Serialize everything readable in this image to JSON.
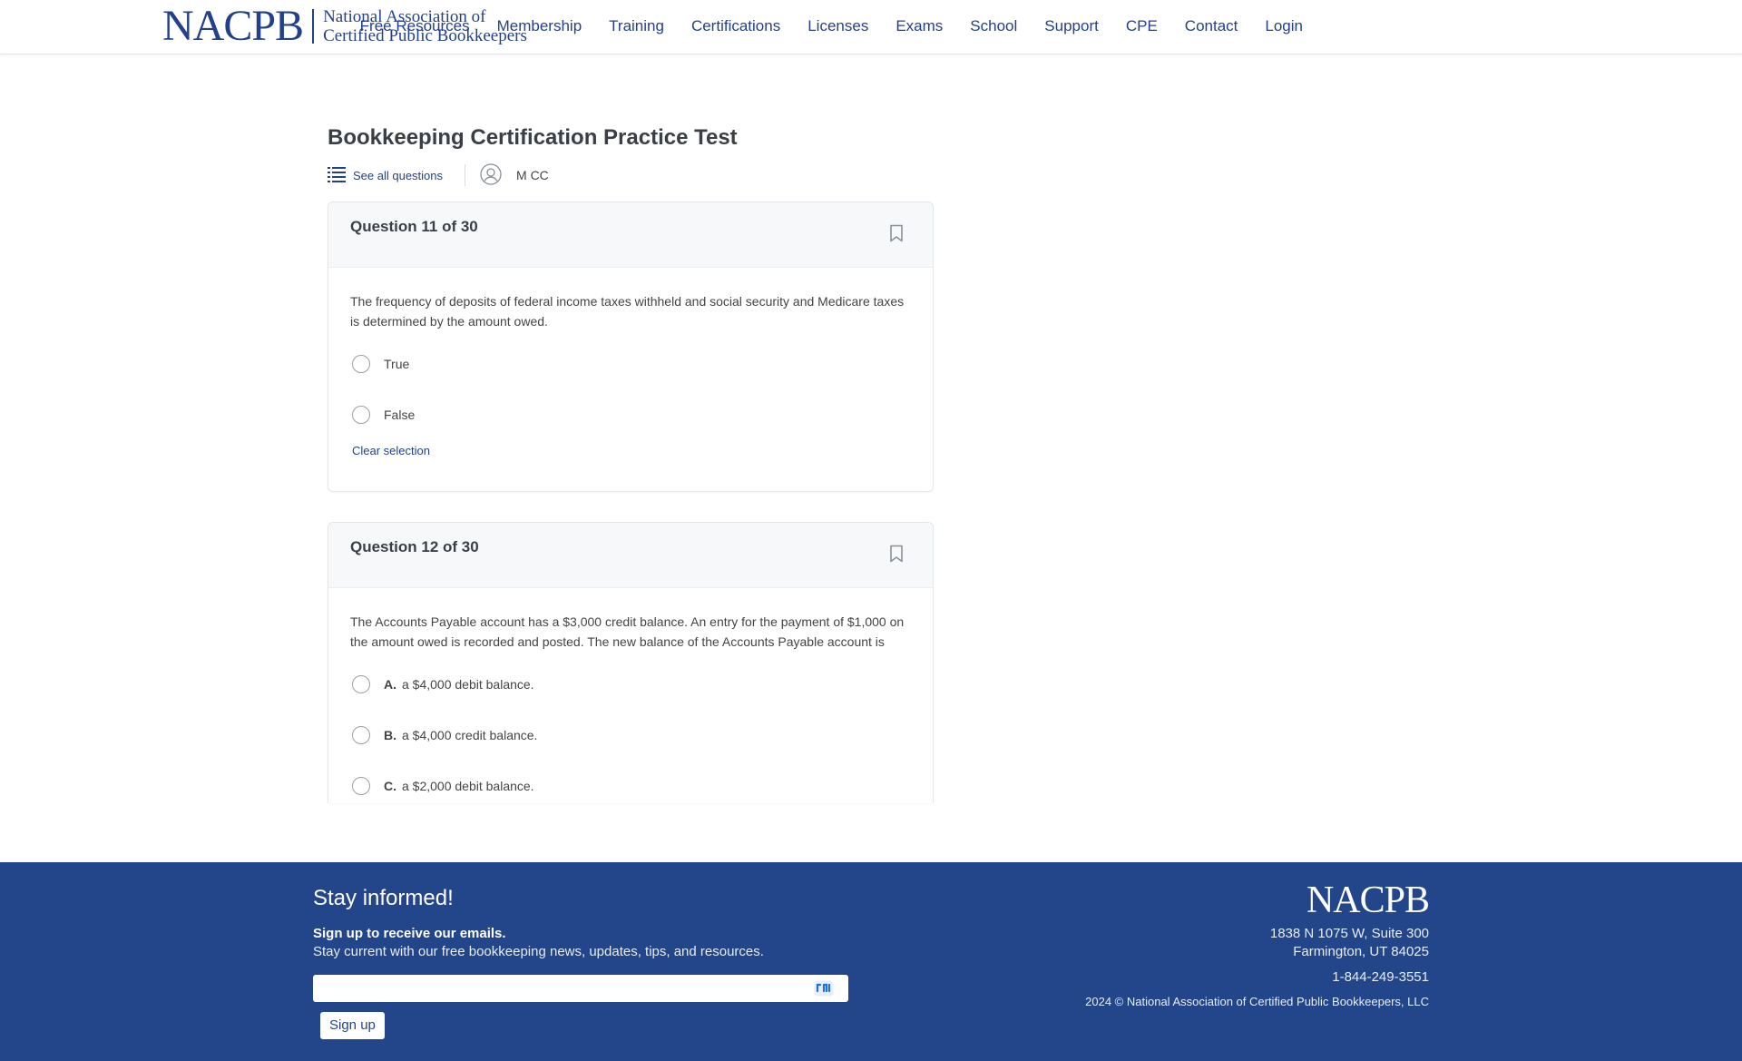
{
  "header": {
    "logo_mark": "NACPB",
    "logo_line1": "National Association of",
    "logo_line2": "Certified Public Bookkeepers",
    "nav": [
      "Free Resources",
      "Membership",
      "Training",
      "Certifications",
      "Licenses",
      "Exams",
      "School",
      "Support",
      "CPE",
      "Contact",
      "Login"
    ]
  },
  "page": {
    "title": "Bookkeeping Certification Practice Test",
    "see_all": "See all questions",
    "user_name": "M CC"
  },
  "questions": [
    {
      "label": "Question 11 of 30",
      "text": "The frequency of deposits of federal income taxes withheld and social security and Medicare taxes is determined by the amount owed.",
      "options": [
        {
          "letter": "",
          "text": "True"
        },
        {
          "letter": "",
          "text": "False"
        }
      ],
      "clear_label": "Clear selection"
    },
    {
      "label": "Question 12 of 30",
      "text": "The Accounts Payable account has a $3,000 credit balance. An entry for the payment of $1,000 on the amount owed is recorded and posted. The new balance of the Accounts Payable account is",
      "options": [
        {
          "letter": "A.",
          "text": "a $4,000 debit balance."
        },
        {
          "letter": "B.",
          "text": "a $4,000 credit balance."
        },
        {
          "letter": "C.",
          "text": "a $2,000 debit balance."
        }
      ]
    }
  ],
  "footer": {
    "heading": "Stay informed!",
    "subheading": "Sign up to receive our emails.",
    "description": "Stay current with our free bookkeeping news, updates, tips, and resources.",
    "signup_label": "Sign up",
    "logo": "NACPB",
    "address_line1": "1838 N 1075 W, Suite 300",
    "address_line2": "Farmington, UT 84025",
    "phone": "1-844-249-3551",
    "copyright": "2024 © National Association of Certified Public Bookkeepers, LLC"
  },
  "colors": {
    "brand": "#23418a",
    "footer_bg": "#23468b"
  }
}
